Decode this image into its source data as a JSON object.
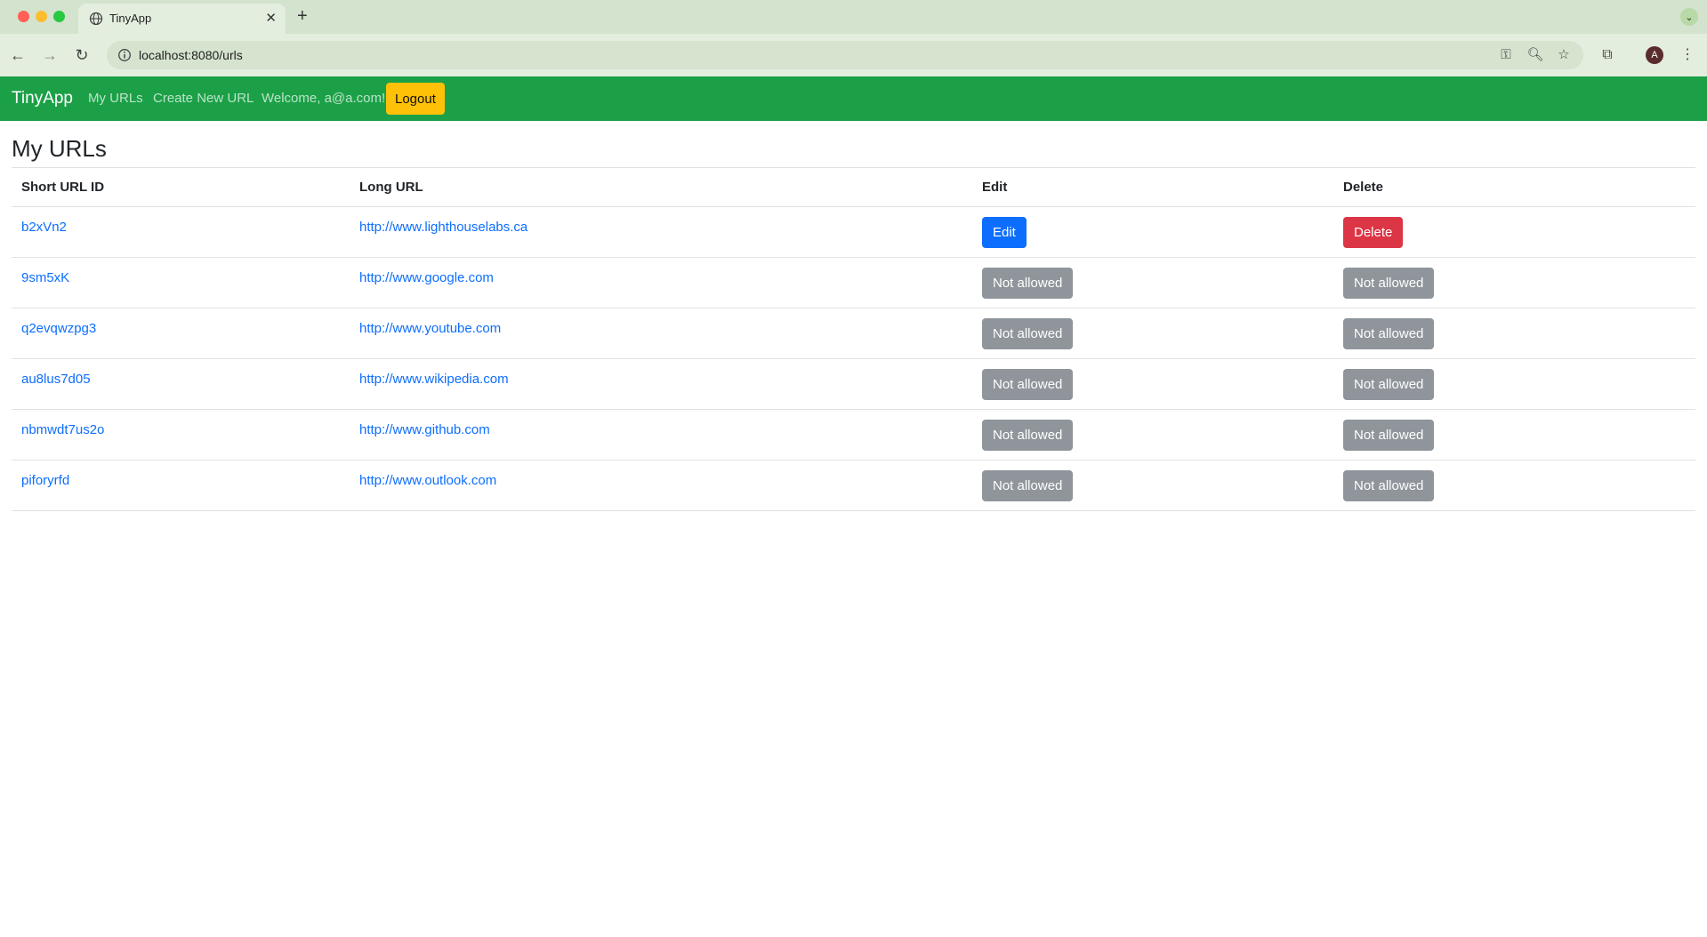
{
  "browser": {
    "tab_title": "TinyApp",
    "url": "localhost:8080/urls",
    "avatar_initial": "A"
  },
  "navbar": {
    "brand": "TinyApp",
    "links": [
      "My URLs",
      "Create New URL"
    ],
    "welcome": "Welcome, a@a.com!",
    "logout_label": "Logout"
  },
  "page": {
    "title": "My URLs"
  },
  "table": {
    "headers": [
      "Short URL ID",
      "Long URL",
      "Edit",
      "Delete"
    ],
    "rows": [
      {
        "short_id": "b2xVn2",
        "long_url": "http://www.lighthouselabs.ca",
        "edit": "Edit",
        "delete": "Delete"
      },
      {
        "short_id": "9sm5xK",
        "long_url": "http://www.google.com",
        "edit": "Not allowed",
        "delete": "Not allowed"
      },
      {
        "short_id": "q2evqwzpg3",
        "long_url": "http://www.youtube.com",
        "edit": "Not allowed",
        "delete": "Not allowed"
      },
      {
        "short_id": "au8lus7d05",
        "long_url": "http://www.wikipedia.com",
        "edit": "Not allowed",
        "delete": "Not allowed"
      },
      {
        "short_id": "nbmwdt7us2o",
        "long_url": "http://www.github.com",
        "edit": "Not allowed",
        "delete": "Not allowed"
      },
      {
        "short_id": "piforyrfd",
        "long_url": "http://www.outlook.com",
        "edit": "Not allowed",
        "delete": "Not allowed"
      }
    ]
  },
  "colors": {
    "navbar_bg": "#1ba047",
    "logout_bg": "#ffc107",
    "link": "#0d6efd",
    "edit_btn": "#0d6efd",
    "delete_btn": "#dc3545",
    "disabled_btn": "#8f959b"
  }
}
